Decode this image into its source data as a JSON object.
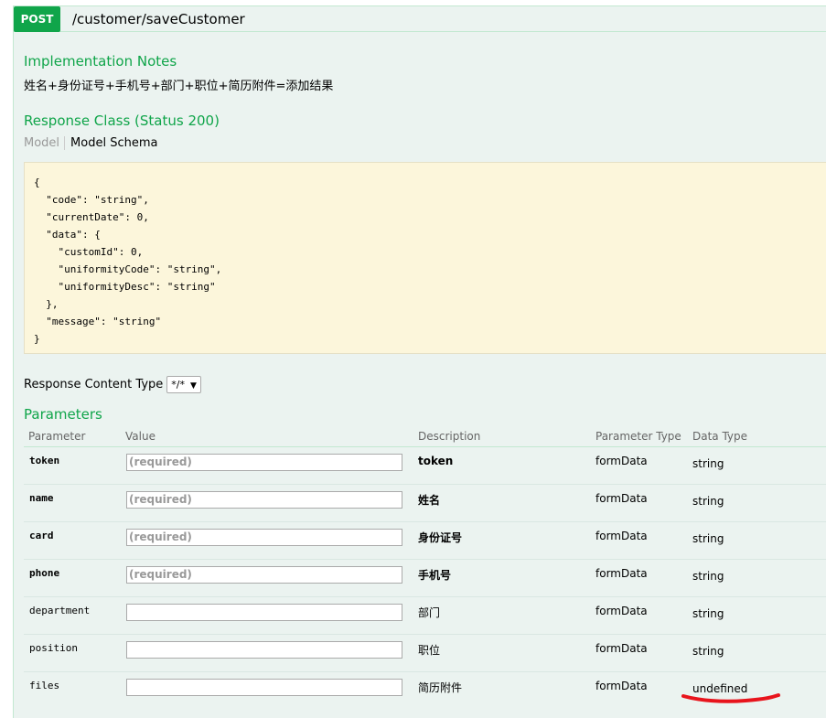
{
  "endpoint": {
    "method": "POST",
    "path": "/customer/saveCustomer"
  },
  "implementation": {
    "title": "Implementation Notes",
    "text": "姓名+身份证号+手机号+部门+职位+简历附件=添加结果"
  },
  "response_class": {
    "title": "Response Class (Status 200)",
    "tab_model": "Model",
    "tab_schema": "Model Schema",
    "schema": "{\n  \"code\": \"string\",\n  \"currentDate\": 0,\n  \"data\": {\n    \"customId\": 0,\n    \"uniformityCode\": \"string\",\n    \"uniformityDesc\": \"string\"\n  },\n  \"message\": \"string\"\n}"
  },
  "content_type": {
    "label": "Response Content Type",
    "selected": "*/*"
  },
  "parameters": {
    "title": "Parameters",
    "headers": {
      "parameter": "Parameter",
      "value": "Value",
      "description": "Description",
      "parameter_type": "Parameter Type",
      "data_type": "Data Type"
    },
    "rows": [
      {
        "name": "token",
        "placeholder": "(required)",
        "description": "token",
        "param_type": "formData",
        "data_type": "string",
        "required": true
      },
      {
        "name": "name",
        "placeholder": "(required)",
        "description": "姓名",
        "param_type": "formData",
        "data_type": "string",
        "required": true
      },
      {
        "name": "card",
        "placeholder": "(required)",
        "description": "身份证号",
        "param_type": "formData",
        "data_type": "string",
        "required": true
      },
      {
        "name": "phone",
        "placeholder": "(required)",
        "description": "手机号",
        "param_type": "formData",
        "data_type": "string",
        "required": true
      },
      {
        "name": "department",
        "placeholder": "",
        "description": "部门",
        "param_type": "formData",
        "data_type": "string",
        "required": false
      },
      {
        "name": "position",
        "placeholder": "",
        "description": "职位",
        "param_type": "formData",
        "data_type": "string",
        "required": false
      },
      {
        "name": "files",
        "placeholder": "",
        "description": "简历附件",
        "param_type": "formData",
        "data_type": "undefined",
        "required": false
      }
    ]
  },
  "colors": {
    "post_green": "#10a54a",
    "panel_bg": "#ebf3f0",
    "schema_bg": "#fcf6db",
    "annotation_red": "#e8141c"
  }
}
